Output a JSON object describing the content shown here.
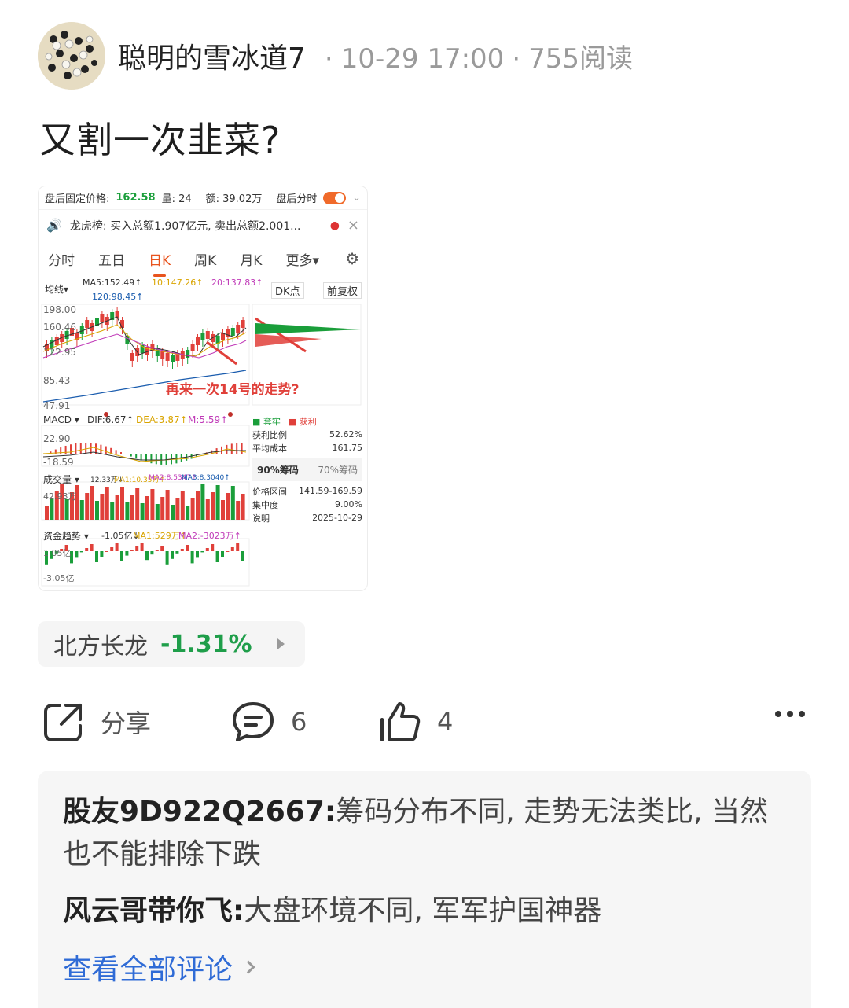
{
  "author": {
    "name": "聪明的雪冰道7",
    "time": "10-29 17:00",
    "reads": "755阅读",
    "dot": "·"
  },
  "post": {
    "title": "又割一次韭菜?"
  },
  "screenshot": {
    "row1": {
      "label_price": "盘后固定价格:",
      "price": "162.58",
      "label_vol": "量: 24",
      "amount": "额: 39.02万",
      "after_hours": "盘后分时"
    },
    "notice": {
      "text": "龙虎榜: 买入总额1.907亿元, 卖出总额2.001...",
      "close": "×"
    },
    "tabs": [
      "分时",
      "五日",
      "日K",
      "周K",
      "月K",
      "更多▾"
    ],
    "active_tab": "日K",
    "ma": {
      "selector": "均线▾",
      "ma5": "MA5:152.49↑",
      "ma10": "10:147.26↑",
      "ma20": "20:137.83↑",
      "ma120": "120:98.45↑",
      "dk": "DK点",
      "adjust": "前复权"
    },
    "price_axis": [
      "198.00",
      "160.46",
      "122.95",
      "85.43",
      "47.91"
    ],
    "annotation": "再来一次14号的走势?",
    "macd": {
      "name": "MACD ▾",
      "dif": "DIF:6.67↑",
      "dea": "DEA:3.87↑",
      "m": "M:5.59↑",
      "top": "22.90",
      "bottom": "-18.59"
    },
    "volume": {
      "name": "成交量 ▾",
      "v": "12.33万↓",
      "ma1": "MA1:10.35万↑",
      "ma2": "MA2:8.5347↑",
      "ma3": "MA3:8.3040↑",
      "top": "42.93万"
    },
    "capital": {
      "name": "资金趋势 ▾",
      "v": "-1.05亿↓",
      "ma1": "MA1:529万↑",
      "ma2": "MA2:-3023万↑",
      "top": "1.05亿",
      "bottom": "-3.05亿"
    },
    "chip_panel": {
      "legend_trap": "■ 套牢",
      "legend_profit": "■ 获利",
      "profit_ratio_label": "获利比例",
      "profit_ratio": "52.62%",
      "avg_cost_label": "平均成本",
      "avg_cost": "161.75",
      "chip90": "90%筹码",
      "chip70": "70%筹码",
      "range_label": "价格区间",
      "range": "141.59-169.59",
      "concentration_label": "集中度",
      "concentration": "9.00%",
      "note_label": "说明",
      "date": "2025-10-29"
    }
  },
  "stock": {
    "name": "北方长龙",
    "change": "-1.31%"
  },
  "actions": {
    "share": "分享",
    "comments": "6",
    "likes": "4"
  },
  "comments": [
    {
      "user": "股友9D922Q2667",
      "sep": ":",
      "text": "筹码分布不同, 走势无法类比, 当然也不能排除下跌"
    },
    {
      "user": "风云哥带你飞",
      "sep": ":",
      "text": "大盘环境不同, 军军护国神器"
    }
  ],
  "see_all": "查看全部评论",
  "colors": {
    "up": "#e0403a",
    "down": "#1a9e3a",
    "accent": "#e8541e",
    "link": "#2f6bd6"
  }
}
